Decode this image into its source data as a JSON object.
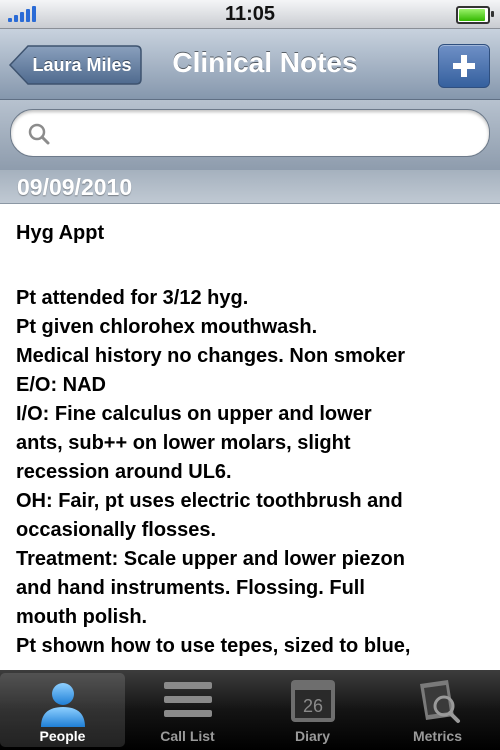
{
  "status_bar": {
    "time": "11:05"
  },
  "nav": {
    "back_label": "Laura Miles",
    "title": "Clinical Notes",
    "add_label": "+"
  },
  "search": {
    "placeholder": ""
  },
  "note": {
    "date": "09/09/2010",
    "title": "Hyg Appt",
    "lines": [
      "Pt attended for 3/12 hyg.",
      "Pt given chlorohex mouthwash.",
      "Medical history no changes. Non smoker",
      "E/O: NAD",
      "I/O: Fine calculus on upper and lower",
      "ants, sub++ on lower molars, slight",
      "recession around UL6.",
      "OH: Fair, pt uses electric toothbrush and",
      "occasionally flosses.",
      "Treatment: Scale upper and lower piezon",
      "and hand instruments. Flossing. Full",
      "mouth polish.",
      "Pt shown how to use tepes, sized to blue,"
    ]
  },
  "tabs": [
    {
      "label": "People",
      "icon": "person-icon",
      "selected": true
    },
    {
      "label": "Call List",
      "icon": "list-icon",
      "selected": false
    },
    {
      "label": "Diary",
      "icon": "calendar-icon",
      "selected": false,
      "date_number": "26"
    },
    {
      "label": "Metrics",
      "icon": "metrics-icon",
      "selected": false
    }
  ],
  "colors": {
    "nav_top": "#c8d2de",
    "nav_bottom": "#8597ad",
    "add_button": "#35609e",
    "tab_active_icon": "#4aa3f0"
  }
}
